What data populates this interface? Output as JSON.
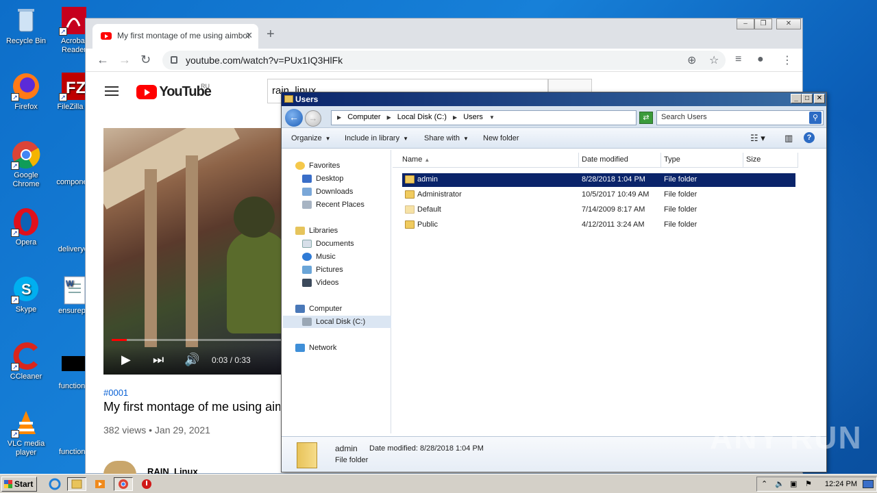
{
  "desktop": {
    "icons": [
      {
        "label": "Recycle Bin",
        "icon": "recycle-bin-icon"
      },
      {
        "label": "Acrobat Reader",
        "icon": "acrobat-icon"
      },
      {
        "label": "Firefox",
        "icon": "firefox-icon"
      },
      {
        "label": "FileZilla C",
        "icon": "filezilla-icon"
      },
      {
        "label": "Google Chrome",
        "icon": "chrome-icon"
      },
      {
        "label": "componen",
        "icon": "file-icon"
      },
      {
        "label": "Opera",
        "icon": "opera-icon"
      },
      {
        "label": "deliveryoi",
        "icon": "file-icon"
      },
      {
        "label": "Skype",
        "icon": "skype-icon"
      },
      {
        "label": "ensurepa",
        "icon": "word-doc-icon"
      },
      {
        "label": "CCleaner",
        "icon": "ccleaner-icon"
      },
      {
        "label": "functionp",
        "icon": "file-icon"
      },
      {
        "label": "VLC media player",
        "icon": "vlc-icon"
      },
      {
        "label": "functions",
        "icon": "file-icon"
      }
    ],
    "watermark": "ANY RUN"
  },
  "chrome": {
    "tab_title": "My first montage of me using aimbot",
    "url": "youtube.com/watch?v=PUx1IQ3HlFk",
    "youtube": {
      "logo_text": "YouTube",
      "region": "RU",
      "search_value": "rain_linux",
      "video_time": "0:03 / 0:33",
      "progress": 0.09,
      "hashtag": "#0001",
      "video_title": "My first montage of me using aimbot",
      "views_date": "382 views • Jan 29, 2021",
      "channel": "RAIN_Linux"
    }
  },
  "explorer": {
    "title": "Users",
    "breadcrumbs": [
      "Computer",
      "Local Disk (C:)",
      "Users"
    ],
    "search_placeholder": "Search Users",
    "commands": {
      "organize": "Organize",
      "include": "Include in library",
      "share": "Share with",
      "new_folder": "New folder"
    },
    "nav": {
      "favorites": "Favorites",
      "desktop": "Desktop",
      "downloads": "Downloads",
      "recent": "Recent Places",
      "libraries": "Libraries",
      "documents": "Documents",
      "music": "Music",
      "pictures": "Pictures",
      "videos": "Videos",
      "computer": "Computer",
      "local_disk": "Local Disk (C:)",
      "network": "Network"
    },
    "columns": {
      "name": "Name",
      "date": "Date modified",
      "type": "Type",
      "size": "Size"
    },
    "rows": [
      {
        "name": "admin",
        "date": "8/28/2018 1:04 PM",
        "type": "File folder"
      },
      {
        "name": "Administrator",
        "date": "10/5/2017 10:49 AM",
        "type": "File folder"
      },
      {
        "name": "Default",
        "date": "7/14/2009 8:17 AM",
        "type": "File folder"
      },
      {
        "name": "Public",
        "date": "4/12/2011 3:24 AM",
        "type": "File folder"
      }
    ],
    "details": {
      "name": "admin",
      "modified_label": "Date modified:",
      "modified_value": "8/28/2018 1:04 PM",
      "type": "File folder"
    }
  },
  "taskbar": {
    "start_label": "Start",
    "clock": "12:24 PM"
  }
}
